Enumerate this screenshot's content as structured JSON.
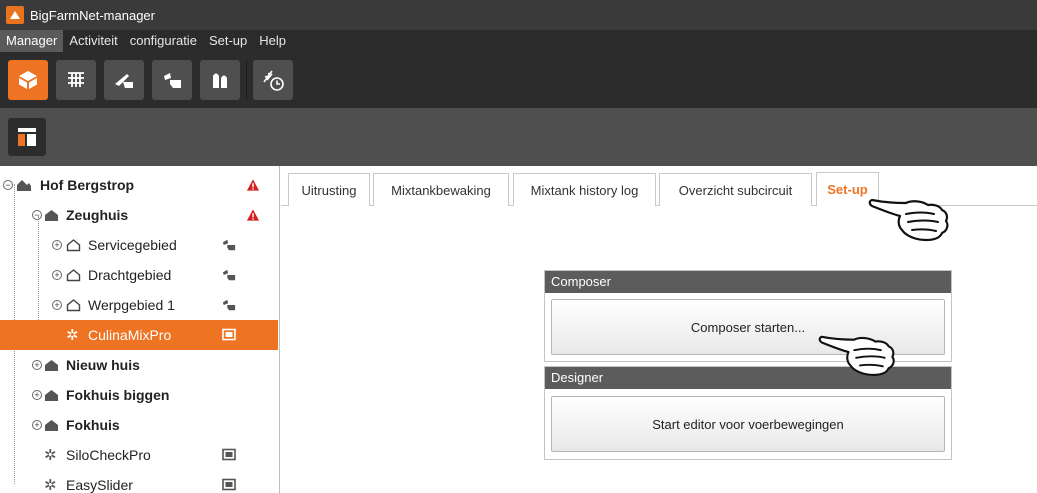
{
  "window": {
    "title": "BigFarmNet-manager"
  },
  "menu": [
    "Manager",
    "Activiteit",
    "configuratie",
    "Set-up",
    "Help"
  ],
  "toolbar": {
    "buttons": [
      {
        "icon": "cube-icon",
        "active": true
      },
      {
        "icon": "grid-icon",
        "active": false
      },
      {
        "icon": "shovel-icon",
        "active": false
      },
      {
        "icon": "feed-icon",
        "active": false
      },
      {
        "icon": "silo-icon",
        "active": false
      }
    ],
    "extra_button": {
      "icon": "feed-clock-icon"
    },
    "sub_button": {
      "icon": "layout-icon"
    }
  },
  "tree": {
    "rows": [
      {
        "label": "Hof Bergstrop",
        "bold": true,
        "icon": "farm-icon",
        "right": "warning-icon"
      },
      {
        "label": "Zeughuis",
        "bold": true,
        "icon": "house-icon",
        "right": "warning-icon"
      },
      {
        "label": "Servicegebied",
        "bold": false,
        "icon": "area-icon",
        "right": "feed-icon"
      },
      {
        "label": "Drachtgebied",
        "bold": false,
        "icon": "area-icon",
        "right": "feed-icon"
      },
      {
        "label": "Werpgebied 1",
        "bold": false,
        "icon": "area-icon",
        "right": "feed-icon"
      },
      {
        "label": "CulinaMixPro",
        "bold": false,
        "icon": "gear-icon",
        "right": "monitor-icon",
        "selected": true
      },
      {
        "label": "Nieuw huis",
        "bold": true,
        "icon": "house-icon"
      },
      {
        "label": "Fokhuis biggen",
        "bold": true,
        "icon": "house-icon"
      },
      {
        "label": "Fokhuis",
        "bold": true,
        "icon": "house-icon"
      },
      {
        "label": "SiloCheckPro",
        "bold": false,
        "icon": "gear-icon",
        "right": "monitor-icon"
      },
      {
        "label": "EasySlider",
        "bold": false,
        "icon": "gear-icon",
        "right": "monitor-icon"
      }
    ]
  },
  "tabs": [
    {
      "label": "Uitrusting"
    },
    {
      "label": "Mixtankbewaking"
    },
    {
      "label": "Mixtank history log"
    },
    {
      "label": "Overzicht subcircuit"
    },
    {
      "label": "Set-up",
      "active": true
    }
  ],
  "panels": {
    "composer": {
      "title": "Composer",
      "button": "Composer starten..."
    },
    "designer": {
      "title": "Designer",
      "button": "Start editor voor voerbewegingen"
    }
  },
  "colors": {
    "accent": "#ee7322",
    "dark": "#2c2c2c",
    "warning": "#d42020"
  }
}
